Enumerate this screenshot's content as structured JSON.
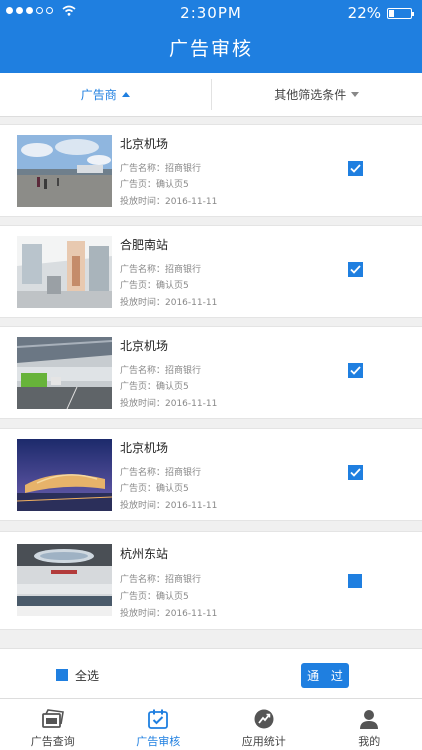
{
  "status_bar": {
    "time": "2:30PM",
    "battery": "22%",
    "battery_level": 0.22
  },
  "header": {
    "title": "广告审核"
  },
  "filters": [
    {
      "label": "广告商",
      "active": true
    },
    {
      "label": "其他筛选条件",
      "active": false
    }
  ],
  "cards": [
    {
      "name": "北京机场",
      "ad_name": "广告名称：招商银行",
      "ad_page": "广告页：确认页5",
      "time": "投放时间：2016-11-11",
      "checked": true,
      "image_icon": "airport-apron-photo"
    },
    {
      "name": "合肥南站",
      "ad_name": "广告名称：招商银行",
      "ad_page": "广告页：确认页5",
      "time": "投放时间：2016-11-11",
      "checked": true,
      "image_icon": "station-hall-photo"
    },
    {
      "name": "北京机场",
      "ad_name": "广告名称：招商银行",
      "ad_page": "广告页：确认页5",
      "time": "投放时间：2016-11-11",
      "checked": true,
      "image_icon": "terminal-roadway-photo"
    },
    {
      "name": "北京机场",
      "ad_name": "广告名称：招商银行",
      "ad_page": "广告页：确认页5",
      "time": "投放时间：2016-11-11",
      "checked": true,
      "image_icon": "terminal-night-photo"
    },
    {
      "name": "杭州东站",
      "ad_name": "广告名称：招商银行",
      "ad_page": "广告页：确认页5",
      "time": "投放时间：2016-11-11",
      "checked": false,
      "image_icon": "station-platform-photo"
    }
  ],
  "bottom_action": {
    "select_all": "全选",
    "pass": "通 过"
  },
  "tabs": [
    {
      "label": "广告查询",
      "icon": "ad-query-icon",
      "active": false
    },
    {
      "label": "广告审核",
      "icon": "calendar-check-icon",
      "active": true
    },
    {
      "label": "应用统计",
      "icon": "stats-trend-icon",
      "active": false
    },
    {
      "label": "我的",
      "icon": "user-icon",
      "active": false
    }
  ],
  "colors": {
    "accent": "#1f7fe0"
  }
}
